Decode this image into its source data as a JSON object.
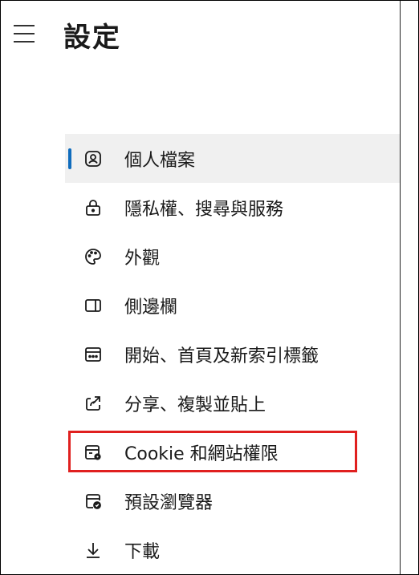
{
  "header": {
    "title": "設定",
    "menu_icon": "hamburger-menu-icon"
  },
  "nav": {
    "items": [
      {
        "label": "個人檔案",
        "icon": "profile-icon",
        "selected": true
      },
      {
        "label": "隱私權、搜尋與服務",
        "icon": "lock-icon",
        "selected": false
      },
      {
        "label": "外觀",
        "icon": "palette-icon",
        "selected": false
      },
      {
        "label": "側邊欄",
        "icon": "sidebar-icon",
        "selected": false
      },
      {
        "label": "開始、首頁及新索引標籤",
        "icon": "home-tab-icon",
        "selected": false
      },
      {
        "label": "分享、複製並貼上",
        "icon": "share-icon",
        "selected": false
      },
      {
        "label": "Cookie 和網站權限",
        "icon": "cookie-site-permissions-icon",
        "selected": false,
        "highlighted": true
      },
      {
        "label": "預設瀏覽器",
        "icon": "default-browser-icon",
        "selected": false
      },
      {
        "label": "下載",
        "icon": "download-icon",
        "selected": false
      }
    ]
  },
  "colors": {
    "selection_accent": "#0f6cbd",
    "selected_background": "#f0f0f0",
    "highlight_border": "#e0201f"
  }
}
